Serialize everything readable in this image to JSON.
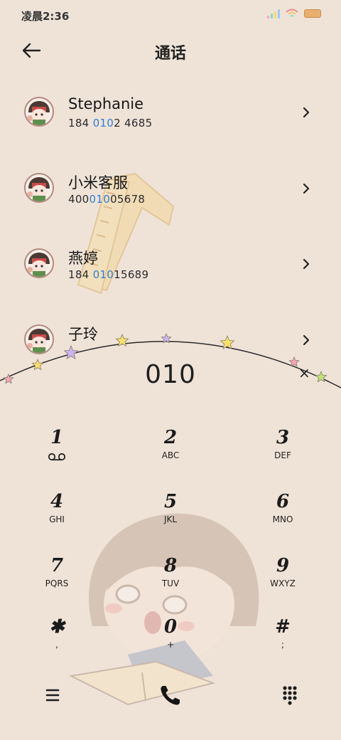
{
  "status_bar": {
    "time": "凌晨2:36",
    "signal_colors": [
      "#f4a6c9",
      "#8fd7b2",
      "#f3d97a",
      "#9cc9f0"
    ],
    "wifi_color": "#f08a8a"
  },
  "header": {
    "title": "通话"
  },
  "contacts": [
    {
      "name": "Stephanie",
      "number_parts": [
        "184 ",
        "010",
        "2 4685"
      ]
    },
    {
      "name": "小米客服",
      "number_parts": [
        "400",
        "010",
        "05678"
      ]
    },
    {
      "name": "燕婷",
      "number_parts": [
        "184 ",
        "010",
        "15689"
      ]
    },
    {
      "name": "子玲",
      "number_parts": [
        "",
        "",
        ""
      ]
    }
  ],
  "dialer": {
    "number": "010",
    "backspace": "×"
  },
  "keypad": [
    {
      "digit": "1",
      "letters": ""
    },
    {
      "digit": "2",
      "letters": "ABC"
    },
    {
      "digit": "3",
      "letters": "DEF"
    },
    {
      "digit": "4",
      "letters": "GHI"
    },
    {
      "digit": "5",
      "letters": "JKL"
    },
    {
      "digit": "6",
      "letters": "MNO"
    },
    {
      "digit": "7",
      "letters": "PQRS"
    },
    {
      "digit": "8",
      "letters": "TUV"
    },
    {
      "digit": "9",
      "letters": "WXYZ"
    },
    {
      "digit": "✱",
      "letters": ","
    },
    {
      "digit": "0",
      "letters": "+"
    },
    {
      "digit": "#",
      "letters": ";"
    }
  ],
  "colors": {
    "highlight": "#2f7fd1",
    "background": "#efe3d8",
    "star_colors": [
      "#f6a7b8",
      "#f7e06b",
      "#c9b3f0",
      "#f7e06b",
      "#c9b3f0",
      "#f7e06b",
      "#f6a7b8",
      "#c4e07c"
    ]
  },
  "icons": {
    "back": "arrow-left-icon",
    "chevron": "chevron-right-icon",
    "voicemail": "voicemail-icon",
    "menu": "menu-icon",
    "call": "phone-icon",
    "dialpad": "dialpad-icon"
  }
}
